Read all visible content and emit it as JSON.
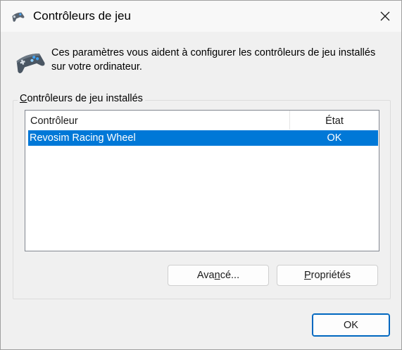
{
  "window": {
    "title": "Contrôleurs de jeu",
    "icon": "gamepad-icon",
    "close_icon": "close-icon"
  },
  "header": {
    "icon": "gamepad-icon",
    "description": "Ces paramètres vous aident à configurer les contrôleurs de jeu installés sur votre ordinateur."
  },
  "group": {
    "label_underlined": "C",
    "label_rest": "ontrôleurs de jeu installés"
  },
  "list": {
    "columns": [
      "Contrôleur",
      "État"
    ],
    "rows": [
      {
        "name": "Revosim Racing Wheel",
        "state": "OK",
        "selected": true
      }
    ]
  },
  "buttons": {
    "advanced_pre": "Ava",
    "advanced_ul": "n",
    "advanced_post": "cé...",
    "properties_ul": "P",
    "properties_rest": "ropriétés",
    "ok": "OK"
  },
  "colors": {
    "selection": "#0078d7",
    "window_bg": "#f0f0f0",
    "ok_border": "#0067c0"
  }
}
